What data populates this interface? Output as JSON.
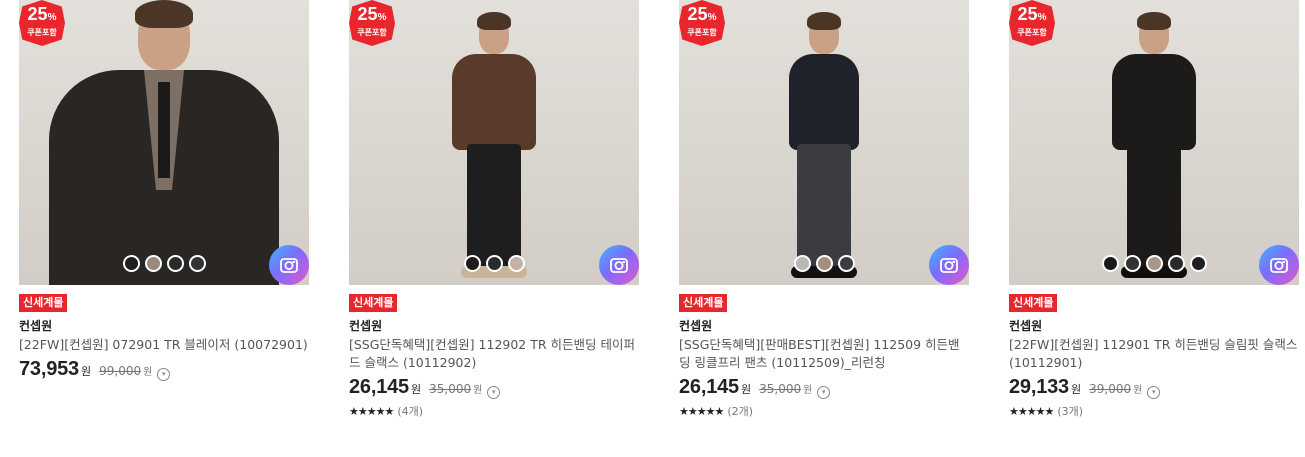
{
  "products": [
    {
      "badge": {
        "percent": "25",
        "percent_sign": "%",
        "label": "쿠폰포함"
      },
      "tag": "신세계몰",
      "brand": "컨셉원",
      "name": "[22FW][컨셉원] 072901 TR 블레이저 (10072901)",
      "price": "73,953",
      "price_unit": "원",
      "original_price": "99,000",
      "original_unit": "원",
      "swatches": [
        "#1e1e1e",
        "#9b8a7e",
        "#2a2a2a",
        "#333333"
      ],
      "camera_icon": "camera-icon",
      "info_icon": "info-icon"
    },
    {
      "badge": {
        "percent": "25",
        "percent_sign": "%",
        "label": "쿠폰포함"
      },
      "tag": "신세계몰",
      "brand": "컨셉원",
      "name": "[SSG단독혜택][컨셉원] 112902 TR 히든밴딩 테이퍼드 슬랙스 (10112902)",
      "price": "26,145",
      "price_unit": "원",
      "original_price": "35,000",
      "original_unit": "원",
      "stars": "★★★★★",
      "review_count": "(4개)",
      "swatches": [
        "#1c1c1c",
        "#2b2b2b",
        "#c3b3a3"
      ],
      "camera_icon": "camera-icon",
      "info_icon": "info-icon"
    },
    {
      "badge": {
        "percent": "25",
        "percent_sign": "%",
        "label": "쿠폰포함"
      },
      "tag": "신세계몰",
      "brand": "컨셉원",
      "name": "[SSG단독혜택][판매BEST][컨셉원] 112509 히든밴딩 링클프리 팬츠 (10112509)_리런칭",
      "price": "26,145",
      "price_unit": "원",
      "original_price": "35,000",
      "original_unit": "원",
      "stars": "★★★★★",
      "review_count": "(2개)",
      "swatches": [
        "#b9b6b4",
        "#a38f7c",
        "#3b3d44"
      ],
      "camera_icon": "camera-icon",
      "info_icon": "info-icon"
    },
    {
      "badge": {
        "percent": "25",
        "percent_sign": "%",
        "label": "쿠폰포함"
      },
      "tag": "신세계몰",
      "brand": "컨셉원",
      "name": "[22FW][컨셉원] 112901 TR 히든밴딩 슬림핏 슬랙스 (10112901)",
      "price": "29,133",
      "price_unit": "원",
      "original_price": "39,000",
      "original_unit": "원",
      "stars": "★★★★★",
      "review_count": "(3개)",
      "swatches": [
        "#1a1a1a",
        "#333333",
        "#a8968a",
        "#2a2a2a",
        "#202020"
      ],
      "camera_icon": "camera-icon",
      "info_icon": "info-icon"
    }
  ]
}
